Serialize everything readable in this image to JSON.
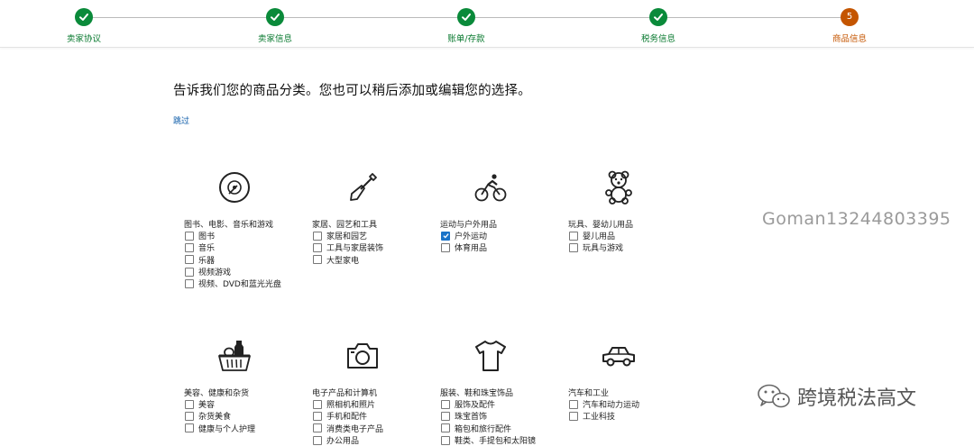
{
  "stepper": {
    "steps": [
      {
        "label": "卖家协议",
        "status": "done"
      },
      {
        "label": "卖家信息",
        "status": "done"
      },
      {
        "label": "账单/存款",
        "status": "done"
      },
      {
        "label": "税务信息",
        "status": "done"
      },
      {
        "label": "商品信息",
        "status": "current",
        "number": "5"
      }
    ]
  },
  "main": {
    "headline": "告诉我们您的商品分类。您也可以稍后添加或编辑您的选择。",
    "skip": "跳过"
  },
  "categories": [
    {
      "title": "图书、电影、音乐和游戏",
      "icon": "disc-icon",
      "options": [
        {
          "label": "图书",
          "checked": false
        },
        {
          "label": "音乐",
          "checked": false
        },
        {
          "label": "乐器",
          "checked": false
        },
        {
          "label": "视频游戏",
          "checked": false
        },
        {
          "label": "视频、DVD和蓝光光盘",
          "checked": false
        }
      ]
    },
    {
      "title": "家居、园艺和工具",
      "icon": "shovel-icon",
      "options": [
        {
          "label": "家居和园艺",
          "checked": false
        },
        {
          "label": "工具与家居装饰",
          "checked": false
        },
        {
          "label": "大型家电",
          "checked": false
        }
      ]
    },
    {
      "title": "运动与户外用品",
      "icon": "cyclist-icon",
      "options": [
        {
          "label": "户外运动",
          "checked": true
        },
        {
          "label": "体育用品",
          "checked": false
        }
      ]
    },
    {
      "title": "玩具、婴幼儿用品",
      "icon": "teddy-bear-icon",
      "options": [
        {
          "label": "婴儿用品",
          "checked": false
        },
        {
          "label": "玩具与游戏",
          "checked": false
        }
      ]
    },
    {
      "title": "美容、健康和杂货",
      "icon": "grocery-basket-icon",
      "options": [
        {
          "label": "美容",
          "checked": false
        },
        {
          "label": "杂货美食",
          "checked": false
        },
        {
          "label": "健康与个人护理",
          "checked": false
        }
      ]
    },
    {
      "title": "电子产品和计算机",
      "icon": "camera-icon",
      "options": [
        {
          "label": "照相机和照片",
          "checked": false
        },
        {
          "label": "手机和配件",
          "checked": false
        },
        {
          "label": "消费类电子产品",
          "checked": false
        },
        {
          "label": "办公用品",
          "checked": false
        }
      ]
    },
    {
      "title": "服装、鞋和珠宝饰品",
      "icon": "tshirt-icon",
      "options": [
        {
          "label": "服饰及配件",
          "checked": false
        },
        {
          "label": "珠宝首饰",
          "checked": false
        },
        {
          "label": "箱包和旅行配件",
          "checked": false
        },
        {
          "label": "鞋类、手提包和太阳镜",
          "checked": false
        }
      ]
    },
    {
      "title": "汽车和工业",
      "icon": "car-icon",
      "options": [
        {
          "label": "汽车和动力运动",
          "checked": false
        },
        {
          "label": "工业科技",
          "checked": false
        }
      ]
    }
  ],
  "overlay": {
    "watermark": "Goman13244803395",
    "brand": "跨境税法高文"
  },
  "colors": {
    "done": "#0a8a3a",
    "current": "#c45500",
    "link": "#0a5aa8"
  }
}
